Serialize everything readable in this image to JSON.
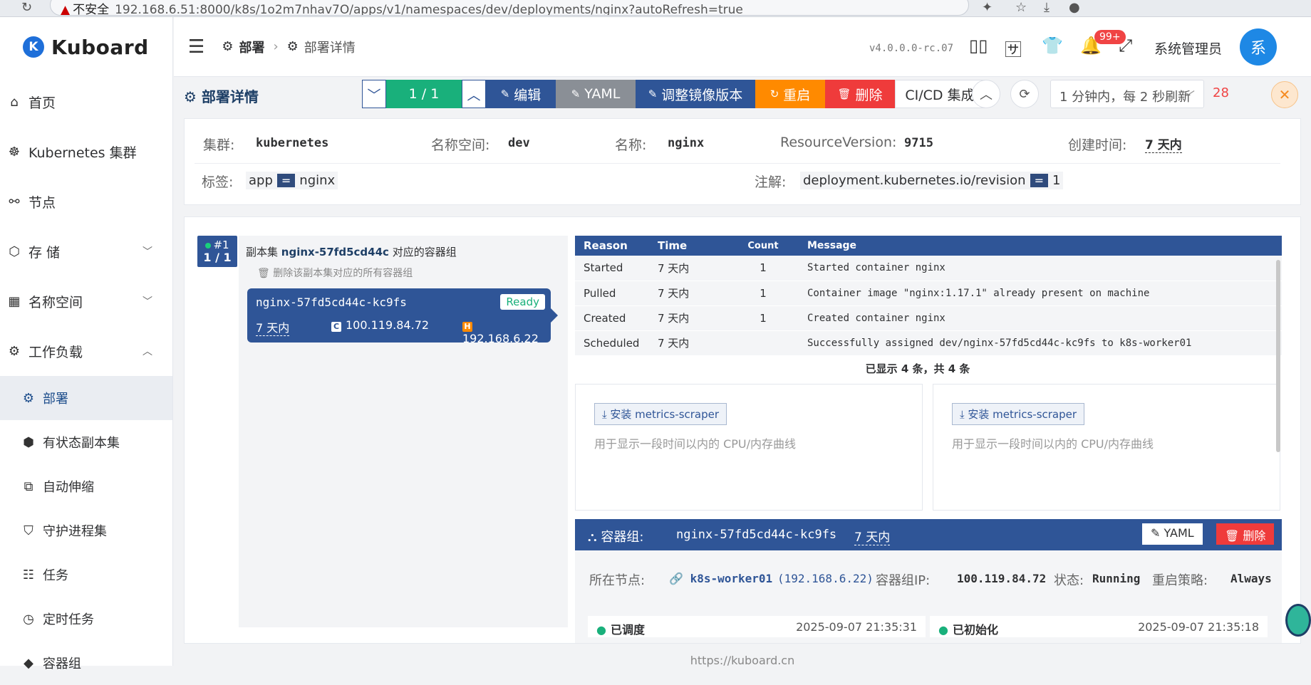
{
  "browser": {
    "insecure_label": "不安全",
    "url": "192.168.6.51:8000/k8s/1o2m7nhav7O/apps/v1/namespaces/dev/deployments/nginx?autoRefresh=true"
  },
  "sidebar": {
    "logo_letter": "K",
    "logo_text": "Kuboard",
    "items": [
      {
        "label": "首页",
        "icon": "home-icon"
      },
      {
        "label": "Kubernetes 集群",
        "icon": "helm-icon"
      },
      {
        "label": "节点",
        "icon": "nodes-icon"
      },
      {
        "label": "存 储",
        "icon": "storage-icon"
      },
      {
        "label": "名称空间",
        "icon": "namespace-icon"
      },
      {
        "label": "工作负载",
        "icon": "workload-icon"
      },
      {
        "label": "部署",
        "icon": "deployment-icon"
      },
      {
        "label": "有状态副本集",
        "icon": "statefulset-icon"
      },
      {
        "label": "自动伸缩",
        "icon": "autoscale-icon"
      },
      {
        "label": "守护进程集",
        "icon": "daemonset-icon"
      },
      {
        "label": "任务",
        "icon": "job-icon"
      },
      {
        "label": "定时任务",
        "icon": "cronjob-icon"
      },
      {
        "label": "容器组",
        "icon": "pod-icon"
      }
    ]
  },
  "header": {
    "breadcrumb_1": "部署",
    "breadcrumb_2": "部署详情",
    "version": "v4.0.0.0-rc.07",
    "notification_count": "99+",
    "user": "系统管理员",
    "avatar_text": "系"
  },
  "toolbar": {
    "title": "部署详情",
    "replicas": "1 / 1",
    "edit": "编辑",
    "yaml": "YAML",
    "adjust_image": "调整镜像版本",
    "restart": "重启",
    "delete": "删除",
    "cicd": "CI/CD 集成",
    "refresh_option": "1 分钟内，每 2 秒刷新",
    "countdown": "28"
  },
  "info": {
    "cluster_label": "集群:",
    "cluster": "kubernetes",
    "namespace_label": "名称空间:",
    "namespace": "dev",
    "name_label": "名称:",
    "name": "nginx",
    "rv_label": "ResourceVersion:",
    "rv": "9715",
    "created_label": "创建时间:",
    "created": "7 天内",
    "labels_label": "标签:",
    "label_key": "app",
    "label_eq": "=",
    "label_value": "nginx",
    "annotations_label": "注解:",
    "annotation_key": "deployment.kubernetes.io/revision",
    "annotation_value": "1"
  },
  "replicaset": {
    "index": "#1",
    "count": "1 / 1",
    "prefix": "副本集",
    "name": "nginx-57fd5cd44c",
    "suffix": "对应的容器组",
    "delete_all": "删除该副本集对应的所有容器组",
    "pod_name": "nginx-57fd5cd44c-kc9fs",
    "pod_status": "Ready",
    "pod_age": "7 天内",
    "pod_ip_chip": "C",
    "pod_ip": "100.119.84.72",
    "host_ip_chip": "H",
    "host_ip": "192.168.6.22"
  },
  "events": {
    "headers": [
      "Reason",
      "Time",
      "Count",
      "Message"
    ],
    "rows": [
      {
        "reason": "Started",
        "time": "7 天内",
        "count": "1",
        "message": "Started container nginx"
      },
      {
        "reason": "Pulled",
        "time": "7 天内",
        "count": "1",
        "message": "Container image \"nginx:1.17.1\" already present on machine"
      },
      {
        "reason": "Created",
        "time": "7 天内",
        "count": "1",
        "message": "Created container nginx"
      },
      {
        "reason": "Scheduled",
        "time": "7 天内",
        "count": "",
        "message": "Successfully assigned dev/nginx-57fd5cd44c-kc9fs to k8s-worker01"
      }
    ],
    "summary": "已显示 4 条，共 4 条"
  },
  "metrics": {
    "install_label": "安装 metrics-scraper",
    "description": "用于显示一段时间以内的 CPU/内存曲线"
  },
  "pod": {
    "label": "容器组:",
    "name": "nginx-57fd5cd44c-kc9fs",
    "age": "7 天内",
    "yaml": "YAML",
    "delete": "删除",
    "node_label": "所在节点:",
    "node": "k8s-worker01",
    "node_ip": "(192.168.6.22)",
    "ip_label": "容器组IP:",
    "ip": "100.119.84.72",
    "status_label": "状态:",
    "status": "Running",
    "restart_label": "重启策略:",
    "restart": "Always",
    "cond1": "已调度",
    "cond1_time": "2025-09-07 21:35:31",
    "cond2": "已初始化",
    "cond2_time": "2025-09-07 21:35:18"
  },
  "footer": "https://kuboard.cn"
}
